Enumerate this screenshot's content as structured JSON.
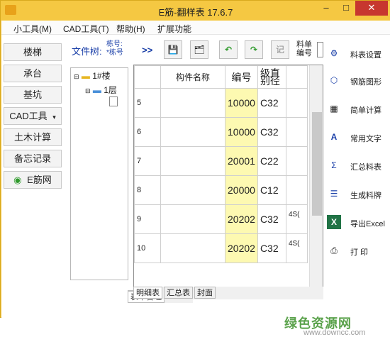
{
  "window": {
    "title": "E筋-翻样表 17.6.7",
    "min": "–",
    "max": "□",
    "close": "✕"
  },
  "menu": [
    "小工具(M)",
    "CAD工具(T)",
    "帮助(H)",
    "扩展功能"
  ],
  "leftnav": [
    "楼梯",
    "承台",
    "基坑",
    "CAD工具",
    "土木计算",
    "备忘记录",
    "E筋网"
  ],
  "tree": {
    "label": "文件树:",
    "sub1": "栋号:",
    "sub2": "*栋号",
    "node1": "1#楼",
    "node2": "1层",
    "tab": "表单管理"
  },
  "toolbar": {
    "expand": ">>",
    "record": "记",
    "header_label": "料单编号"
  },
  "table": {
    "headers": [
      "",
      "构件名称",
      "编号",
      "级直别径",
      ""
    ],
    "rows": [
      {
        "num": "5",
        "name": "",
        "code": "10000",
        "grade": "C32",
        "extra": ""
      },
      {
        "num": "6",
        "name": "",
        "code": "10000",
        "grade": "C32",
        "extra": ""
      },
      {
        "num": "7",
        "name": "",
        "code": "20001",
        "grade": "C22",
        "extra": ""
      },
      {
        "num": "8",
        "name": "",
        "code": "20000",
        "grade": "C12",
        "extra": ""
      },
      {
        "num": "9",
        "name": "",
        "code": "20202",
        "grade": "C32",
        "extra": "4S("
      },
      {
        "num": "10",
        "name": "",
        "code": "20202",
        "grade": "C32",
        "extra": "4S("
      }
    ]
  },
  "tabs": [
    "明细表",
    "汇总表",
    "封面"
  ],
  "rightnav": [
    "料表设置",
    "钢筋图形",
    "简单计算",
    "常用文字",
    "汇总料表",
    "生成料牌",
    "导出Excel",
    "打 印"
  ],
  "watermark": {
    "cn": "绿色资源网",
    "url": "www.downcc.com"
  }
}
